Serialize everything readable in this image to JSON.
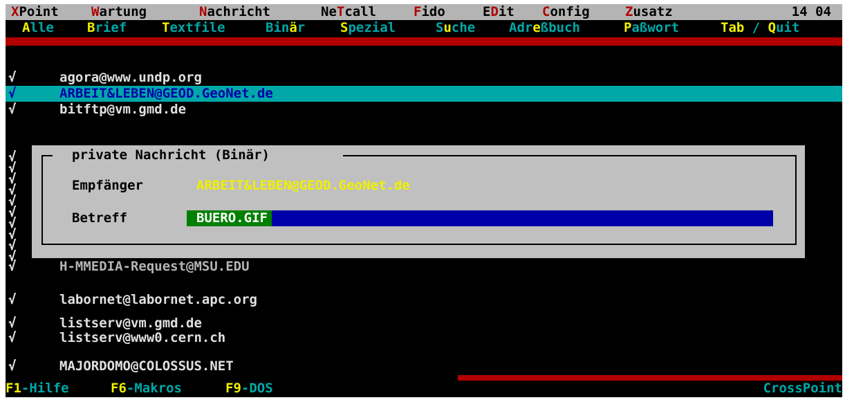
{
  "clock": "14 04",
  "menubar": [
    {
      "hot": "X",
      "rest": "Point"
    },
    {
      "hot": "W",
      "rest": "artung"
    },
    {
      "hot": "N",
      "rest": "achricht"
    },
    {
      "pre": "Ne",
      "hot": "T",
      "rest": "call"
    },
    {
      "hot": "F",
      "rest": "ido"
    },
    {
      "pre": "E",
      "hot": "D",
      "rest": "it"
    },
    {
      "hot": "C",
      "rest": "onfig"
    },
    {
      "hot": "Z",
      "rest": "usatz"
    }
  ],
  "submenu": [
    {
      "hot": "A",
      "rest": "lle"
    },
    {
      "hot": "B",
      "rest": "rief"
    },
    {
      "hot": "T",
      "rest": "extfile"
    },
    {
      "pre": "Bin",
      "hot": "ä",
      "rest": "r"
    },
    {
      "hot": "S",
      "rest": "pezial"
    },
    {
      "pre": "S",
      "hot": "u",
      "rest": "che"
    },
    {
      "pre": "Adr",
      "hot": "e",
      "rest": "ßbuch"
    },
    {
      "hot": "P",
      "rest": "aßwort"
    }
  ],
  "submenu_tab": {
    "tab": "Tab",
    "sep": " / ",
    "quit_hot": "Q",
    "quit_rest": "uit"
  },
  "checkmark": "√",
  "entries": [
    {
      "check": "√",
      "addr": "agora@www.undp.org",
      "selected": false
    },
    {
      "check": "√",
      "addr": "ARBEIT&LEBEN@GEOD.GeoNet.de",
      "selected": true
    },
    {
      "check": "√",
      "addr": "bitftp@vm.gmd.de",
      "selected": false
    },
    {
      "check": "√",
      "addr": "H-MMEDIA-Request@MSU.EDU",
      "selected": false
    },
    {
      "check": "√",
      "addr": "labornet@labornet.apc.org",
      "selected": false
    },
    {
      "check": "√",
      "addr": "listserv@vm.gmd.de",
      "selected": false
    },
    {
      "check": "√",
      "addr": "listserv@www0.cern.ch",
      "selected": false
    },
    {
      "check": "√",
      "addr": "MAJORDOMO@COLOSSUS.NET",
      "selected": false
    }
  ],
  "dialog": {
    "title": "private Nachricht (Binär)",
    "to_label": "Empfänger",
    "to_value": "ARBEIT&LEBEN@GEOD.GeoNet.de",
    "subject_label": "Betreff",
    "subject_value": "BUERO.GIF"
  },
  "statusbar": {
    "keys": [
      {
        "key": "F1",
        "label": "-Hilfe"
      },
      {
        "key": "F6",
        "label": "-Makros"
      },
      {
        "key": "F9",
        "label": "-DOS"
      }
    ],
    "brand": "CrossPoint"
  },
  "colors": {
    "menubar_bg": "#b4b4b4",
    "hotkey_red": "#b00000",
    "hotkey_yellow": "#f0f000",
    "cyan": "#00a8a8",
    "selection_bg": "#00a8a8",
    "dialog_bg": "#c0c0c0",
    "input_bg": "#0000a8",
    "input_value_bg": "#008000"
  }
}
